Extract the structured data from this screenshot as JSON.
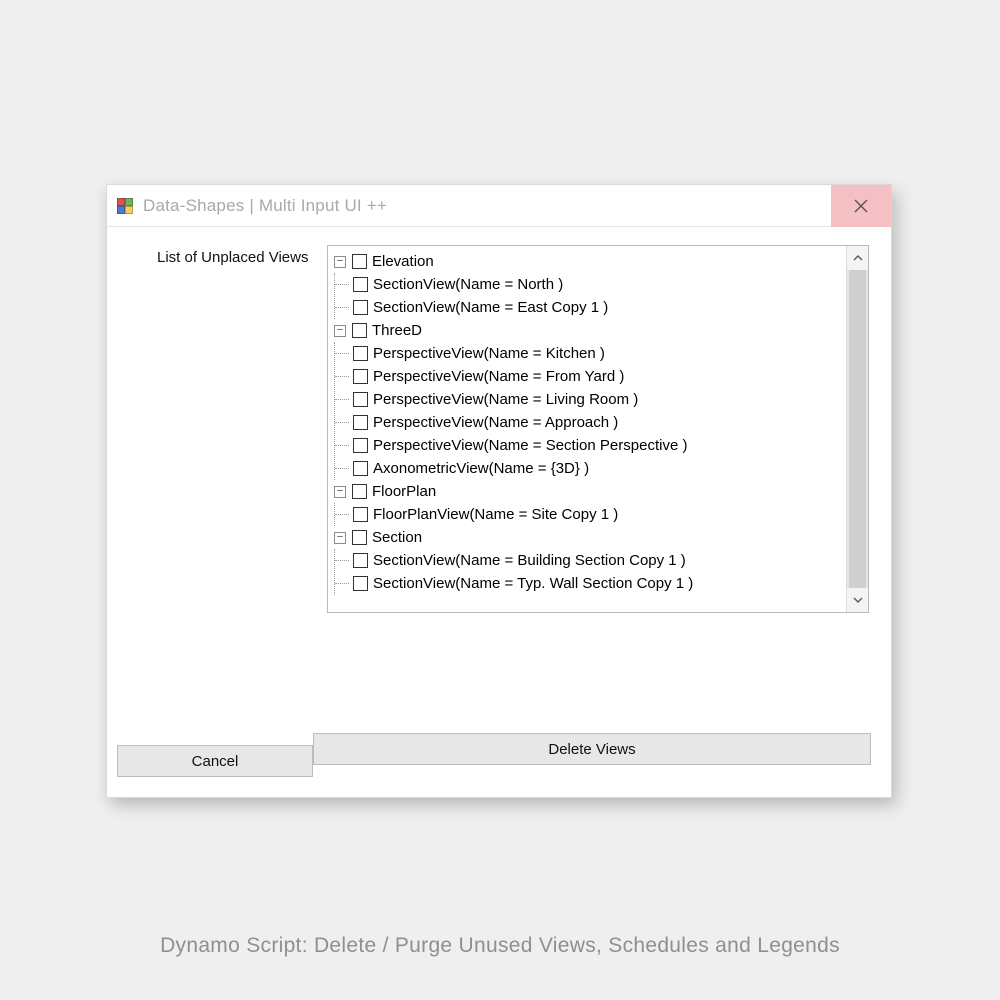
{
  "window": {
    "title": "Data-Shapes | Multi Input UI ++"
  },
  "field_label": "List of Unplaced Views",
  "tree": [
    {
      "label": "Elevation",
      "children": [
        {
          "label": "SectionView(Name = North )"
        },
        {
          "label": "SectionView(Name = East Copy 1 )"
        }
      ]
    },
    {
      "label": "ThreeD",
      "children": [
        {
          "label": "PerspectiveView(Name = Kitchen )"
        },
        {
          "label": "PerspectiveView(Name = From Yard )"
        },
        {
          "label": "PerspectiveView(Name = Living Room )"
        },
        {
          "label": "PerspectiveView(Name = Approach )"
        },
        {
          "label": "PerspectiveView(Name = Section Perspective )"
        },
        {
          "label": "AxonometricView(Name = {3D} )"
        }
      ]
    },
    {
      "label": "FloorPlan",
      "children": [
        {
          "label": "FloorPlanView(Name = Site Copy 1 )"
        }
      ]
    },
    {
      "label": "Section",
      "children": [
        {
          "label": "SectionView(Name = Building Section Copy 1 )"
        },
        {
          "label": "SectionView(Name = Typ. Wall Section Copy 1 )"
        }
      ]
    }
  ],
  "buttons": {
    "cancel": "Cancel",
    "delete": "Delete Views"
  },
  "caption": "Dynamo Script: Delete / Purge Unused Views, Schedules and Legends",
  "expander_glyph": "−"
}
